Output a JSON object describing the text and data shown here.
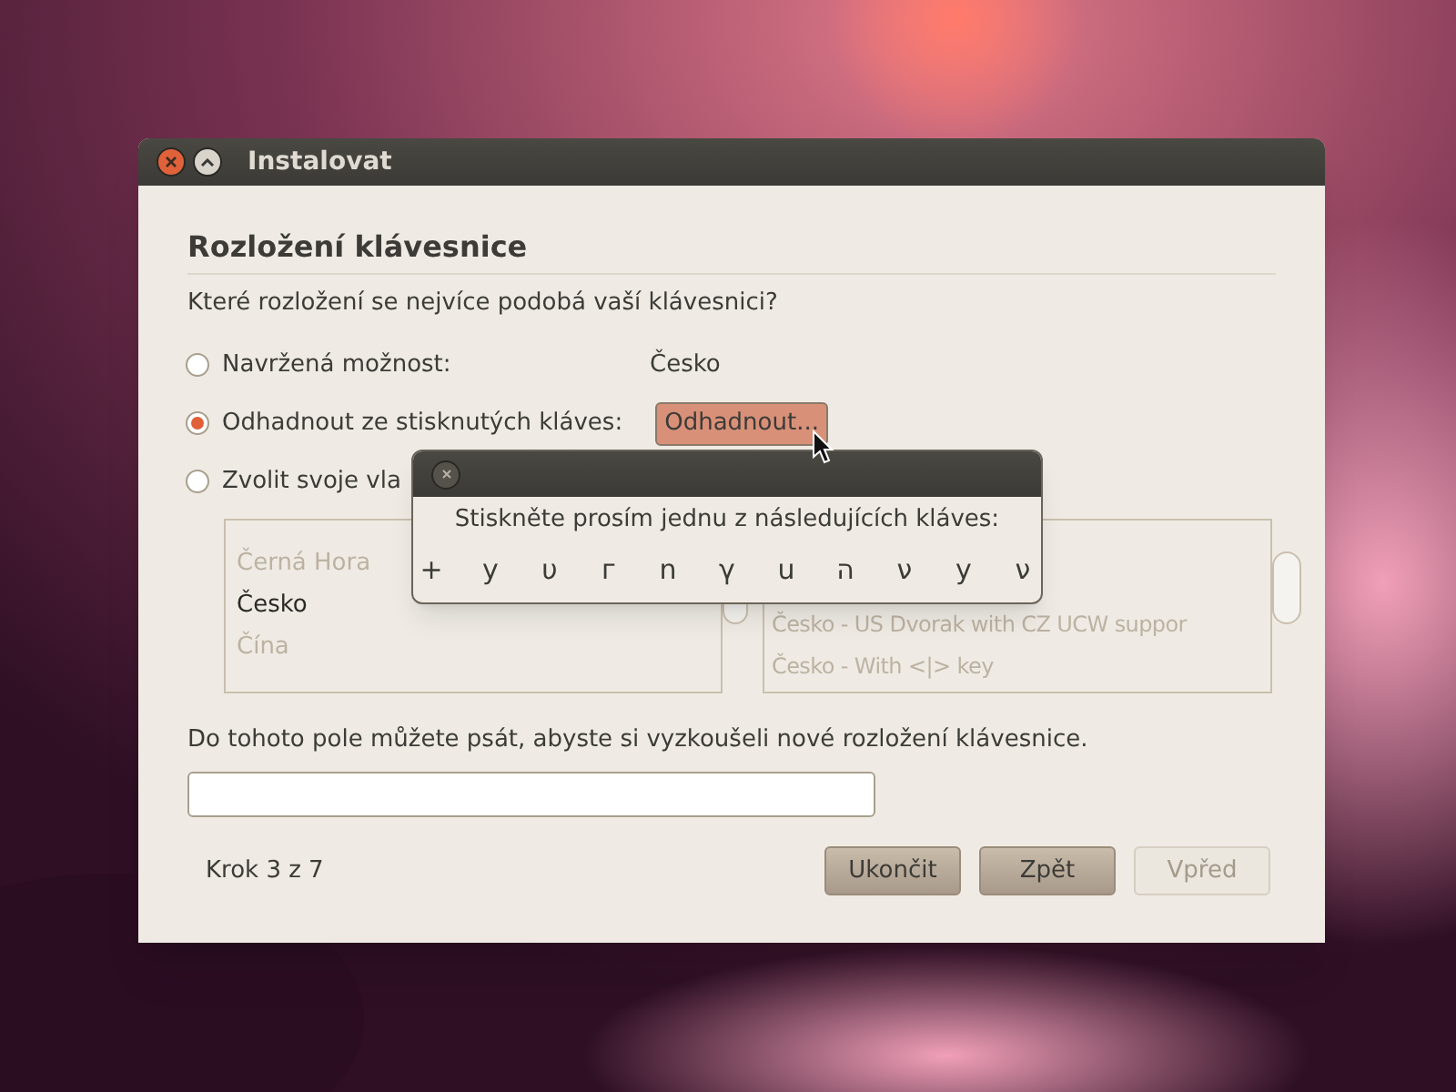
{
  "window": {
    "title": "Instalovat"
  },
  "heading": "Rozložení klávesnice",
  "question": "Které rozložení se nejvíce podobá vaší klávesnici?",
  "options": [
    {
      "label": "Navržená možnost:",
      "selected": false,
      "kind": "value",
      "value": "Česko"
    },
    {
      "label": "Odhadnout ze stisknutých kláves:",
      "selected": true,
      "kind": "button",
      "button": "Odhadnout..."
    },
    {
      "label": "Zvolit svoje vla",
      "selected": false,
      "kind": "lists"
    }
  ],
  "layout_list": {
    "items": [
      {
        "label": "Černá Hora",
        "selected": false
      },
      {
        "label": "Česko",
        "selected": true
      },
      {
        "label": "Čína",
        "selected": false
      }
    ]
  },
  "variant_list": {
    "items": [
      {
        "label": "Česko - US Dvorak with CZ UCW suppor",
        "selected": false
      },
      {
        "label": "Česko - With <|> key",
        "selected": false
      }
    ]
  },
  "test_label": "Do tohoto pole můžete psát, abyste si vyzkoušeli nové rozložení klávesnice.",
  "step": "Krok 3 z 7",
  "buttons": [
    {
      "label": "Ukončit",
      "disabled": false
    },
    {
      "label": "Zpět",
      "disabled": false
    },
    {
      "label": "Vpřed",
      "disabled": true
    }
  ],
  "popup": {
    "prompt": "Stiskněte prosím jednu z následujících kláves:",
    "keys": [
      "+",
      "у",
      "υ",
      "г",
      "n",
      "γ",
      "u",
      "ה",
      "ν",
      "у",
      "ν"
    ]
  }
}
